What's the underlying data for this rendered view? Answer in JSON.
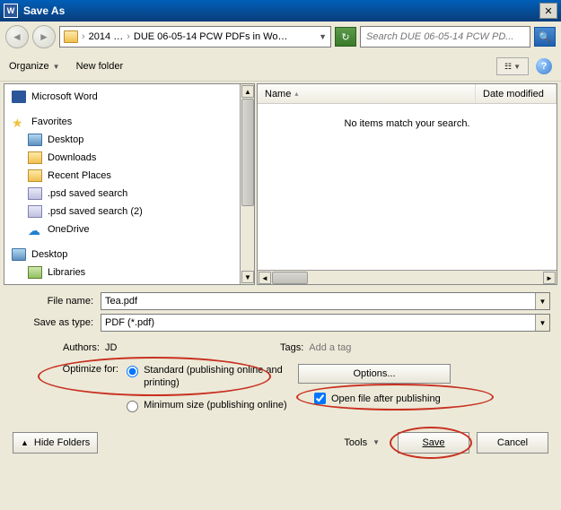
{
  "title": "Save As",
  "breadcrumb": {
    "part1": "2014 …",
    "part2": "DUE 06-05-14 PCW PDFs in Wo…"
  },
  "search": {
    "placeholder": "Search DUE 06-05-14 PCW PD..."
  },
  "toolbar": {
    "organize": "Organize",
    "new_folder": "New folder"
  },
  "tree": {
    "word": "Microsoft Word",
    "favorites": "Favorites",
    "items": [
      "Desktop",
      "Downloads",
      "Recent Places",
      ".psd saved search",
      ".psd saved search (2)",
      "OneDrive"
    ],
    "desktop": "Desktop",
    "libraries": "Libraries"
  },
  "filelist": {
    "col_name": "Name",
    "col_date": "Date modified",
    "empty": "No items match your search."
  },
  "form": {
    "filename_label": "File name:",
    "filename_value": "Tea.pdf",
    "savetype_label": "Save as type:",
    "savetype_value": "PDF (*.pdf)",
    "authors_label": "Authors:",
    "authors_value": "JD",
    "tags_label": "Tags:",
    "tags_placeholder": "Add a tag"
  },
  "optimize": {
    "label": "Optimize for:",
    "standard": "Standard (publishing online and printing)",
    "minimum": "Minimum size (publishing online)"
  },
  "options": {
    "button": "Options...",
    "open_after": "Open file after publishing"
  },
  "footer": {
    "hide": "Hide Folders",
    "tools": "Tools",
    "save": "Save",
    "cancel": "Cancel"
  }
}
